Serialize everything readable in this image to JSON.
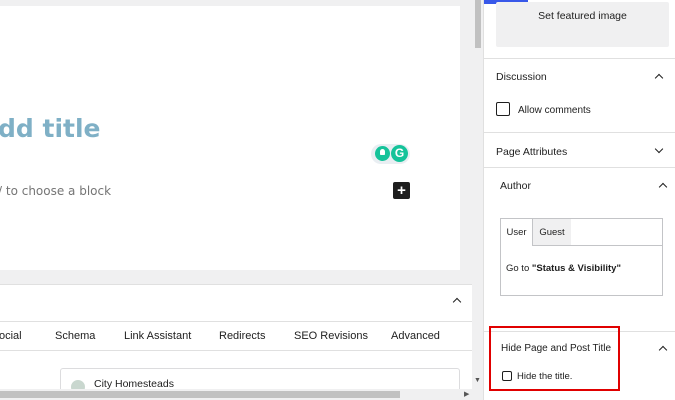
{
  "editor": {
    "title_placeholder": "dd title",
    "block_placeholder": "/ to choose a block",
    "add_block_symbol": "+",
    "grammarly_letter": "G"
  },
  "seo_panel": {
    "collapse_symbol": "⌃",
    "tabs": [
      "ocial",
      "Schema",
      "Link Assistant",
      "Redirects",
      "SEO Revisions",
      "Advanced"
    ],
    "card_title": "City Homesteads"
  },
  "sidebar": {
    "featured_image_button": "Set featured image",
    "discussion": {
      "title": "Discussion",
      "allow_comments_label": "Allow comments",
      "allow_comments_checked": false
    },
    "page_attributes": {
      "title": "Page Attributes"
    },
    "author": {
      "title": "Author",
      "tabs": [
        "User",
        "Guest"
      ],
      "active_tab": "User",
      "goto_prefix": "Go to ",
      "goto_target": "\"Status & Visibility\""
    },
    "hide_title": {
      "title": "Hide Page and Post Title",
      "checkbox_label": "Hide the title.",
      "checked": false
    }
  },
  "colors": {
    "accent": "#3858e9",
    "highlight_border": "#e00000",
    "title_placeholder": "#7fb0c6",
    "grammarly_green": "#15c39a"
  }
}
